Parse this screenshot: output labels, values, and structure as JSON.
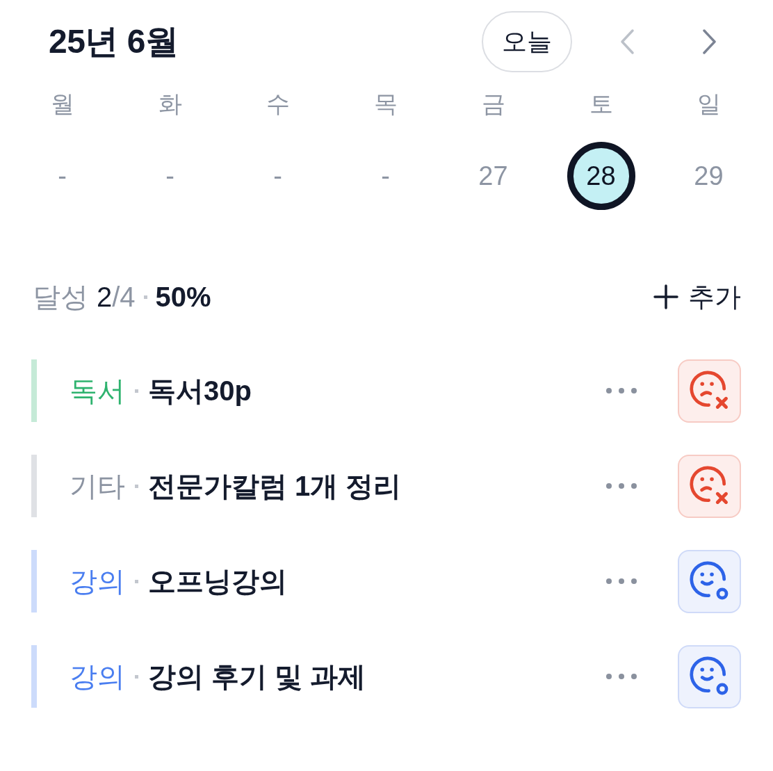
{
  "header": {
    "title": "25년 6월",
    "today_button": "오늘",
    "prev_button": {
      "disabled": true
    },
    "next_button": {
      "disabled": false
    }
  },
  "week": [
    {
      "weekday": "월",
      "date": "-",
      "selected": false
    },
    {
      "weekday": "화",
      "date": "-",
      "selected": false
    },
    {
      "weekday": "수",
      "date": "-",
      "selected": false
    },
    {
      "weekday": "목",
      "date": "-",
      "selected": false
    },
    {
      "weekday": "금",
      "date": "27",
      "selected": false
    },
    {
      "weekday": "토",
      "date": "28",
      "selected": true
    },
    {
      "weekday": "일",
      "date": "29",
      "selected": false
    }
  ],
  "summary": {
    "label": "달성",
    "done": "2",
    "total": "/4",
    "percent": "50%"
  },
  "add_button": "추가",
  "tasks": [
    {
      "category": "독서",
      "color": "#2fb36f",
      "title": "독서30p",
      "achieved": false
    },
    {
      "category": "기타",
      "color": "#8b93a1",
      "title": "전문가칼럼 1개 정리",
      "achieved": false
    },
    {
      "category": "강의",
      "color": "#4a7ef0",
      "title": "오프닝강의",
      "achieved": true
    },
    {
      "category": "강의",
      "color": "#4a7ef0",
      "title": "강의 후기 및 과제",
      "achieved": true
    }
  ]
}
